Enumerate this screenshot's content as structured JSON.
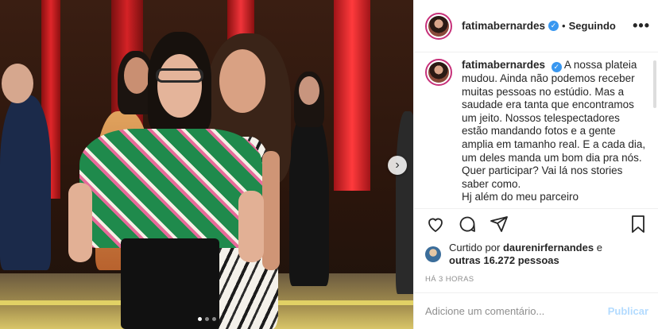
{
  "post": {
    "username": "fatimabernardes",
    "follow_status": "Seguindo",
    "more_icon": "•••",
    "caption_lines": [
      "A nossa plateia",
      "mudou. Ainda não podemos receber",
      "muitas pessoas no estúdio. Mas a",
      "saudade era tanta que encontramos",
      "um jeito. Nossos telespectadores",
      "estão mandando fotos e a gente",
      "amplia em tamanho real. E a cada dia,",
      "um deles manda um bom dia pra nós.",
      "Quer participar? Vai lá nos stories",
      "saber como.",
      "Hj além do meu parceiro"
    ],
    "liked_by_prefix": "Curtido por",
    "liked_by_user": "daurenirfernandes",
    "liked_by_joiner": "e",
    "others_label": "outras 16.272 pessoas",
    "time_ago": "HÁ 3 HORAS",
    "comment_placeholder": "Adicione um comentário...",
    "publish_label": "Publicar"
  },
  "carousel": {
    "current": 1,
    "total": 3
  },
  "colors": {
    "verified": "#3897f0",
    "publish_disabled": "#b3dbff",
    "text": "#262626",
    "muted": "#8e8e8e"
  },
  "icons": [
    "heart-icon",
    "comment-icon",
    "share-icon",
    "bookmark-icon",
    "verified-icon",
    "next-arrow-icon"
  ]
}
